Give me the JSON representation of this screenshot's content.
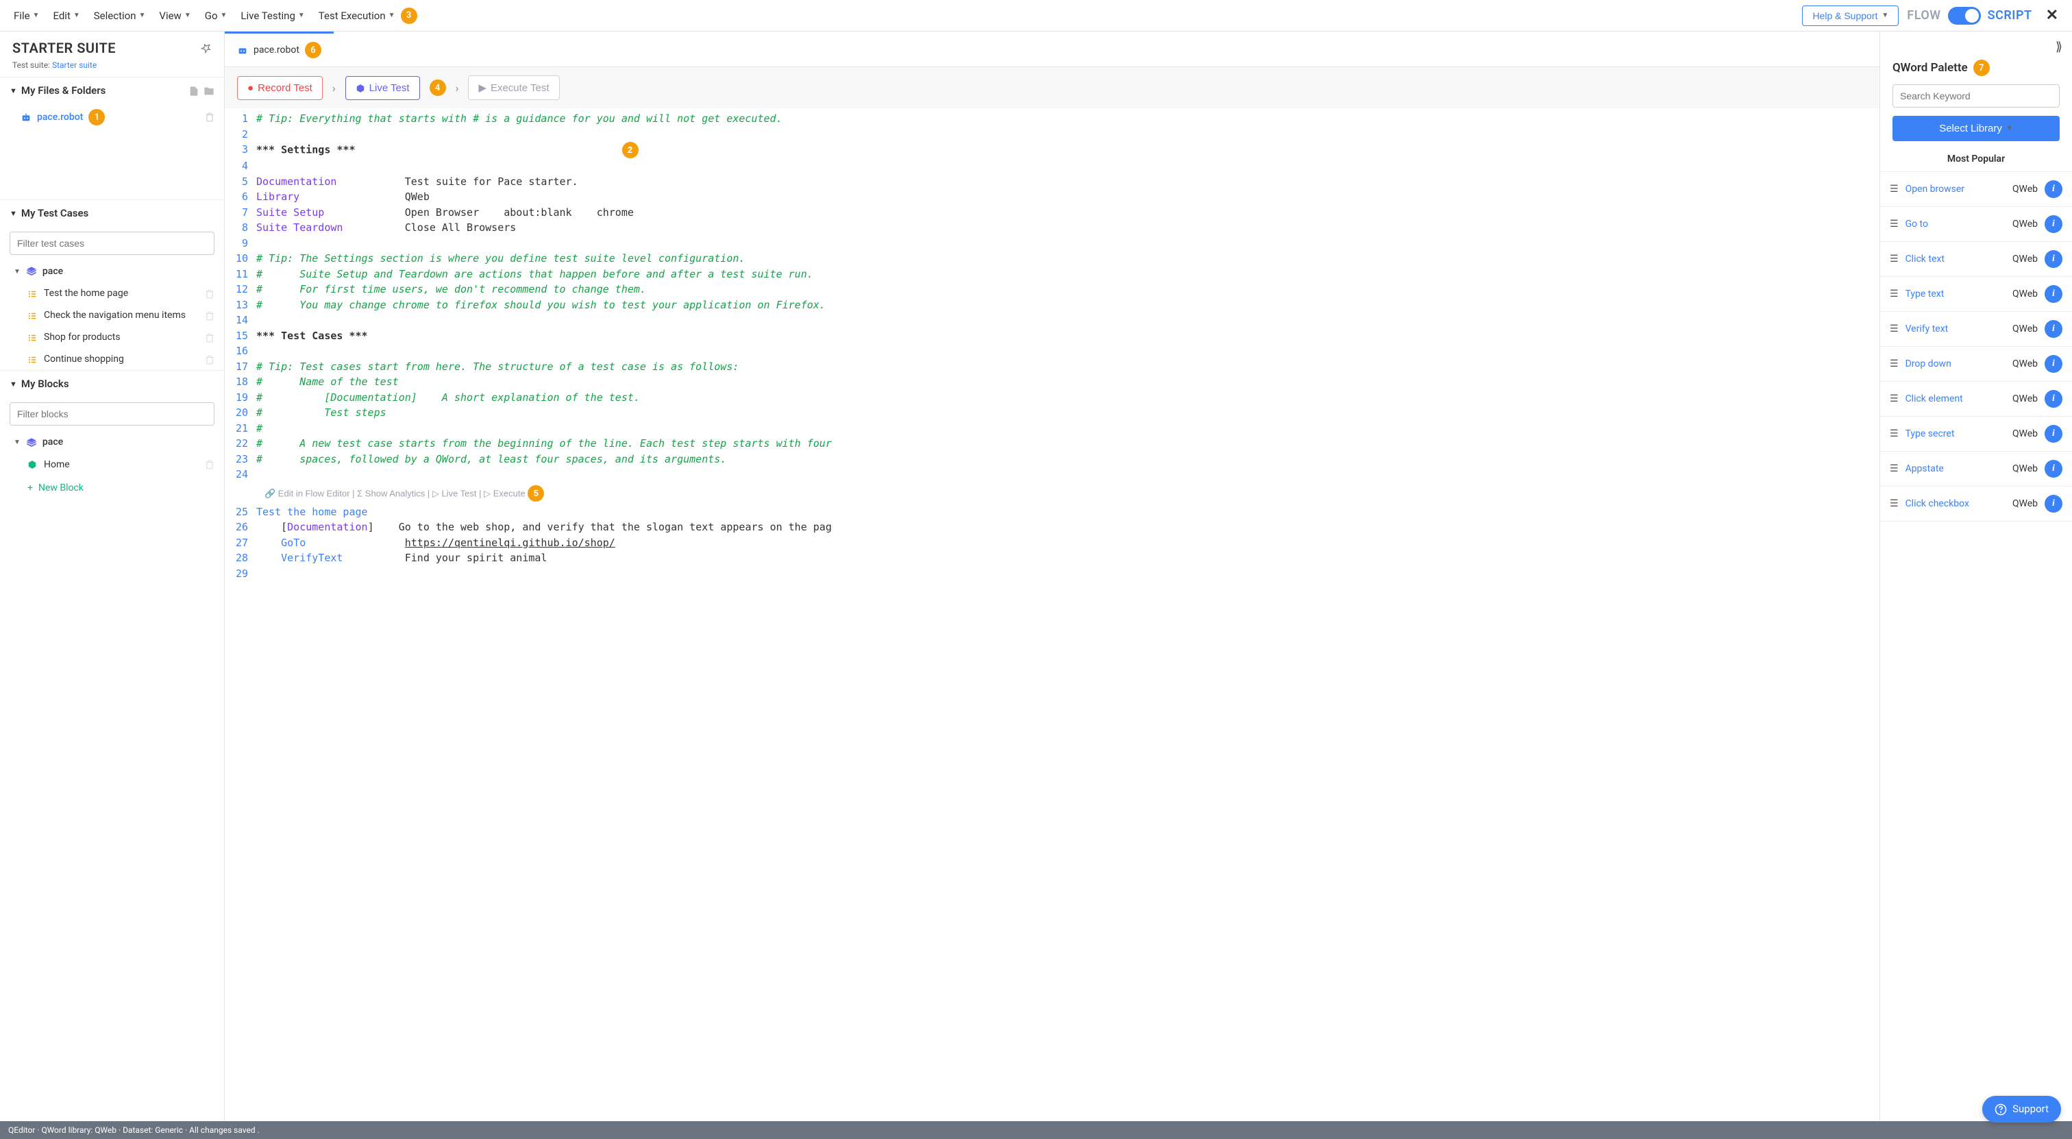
{
  "menubar": {
    "items": [
      "File",
      "Edit",
      "Selection",
      "View",
      "Go",
      "Live Testing",
      "Test Execution"
    ],
    "help": "Help & Support",
    "flow": "FLOW",
    "script": "SCRIPT"
  },
  "badges": {
    "menubar": "3",
    "file": "1",
    "tab": "6",
    "live": "4",
    "code": "2",
    "palette": "7",
    "execute": "5"
  },
  "sidebar": {
    "suite_title": "STARTER SUITE",
    "suite_sub_label": "Test suite: ",
    "suite_sub_link": "Starter suite",
    "files_header": "My Files & Folders",
    "file_name": "pace.robot",
    "testcases_header": "My Test Cases",
    "filter_tc_placeholder": "Filter test cases",
    "tc_group": "pace",
    "testcases": [
      "Test the home page",
      "Check the navigation menu items",
      "Shop for products",
      "Continue shopping"
    ],
    "blocks_header": "My Blocks",
    "filter_blocks_placeholder": "Filter blocks",
    "block_group": "pace",
    "blocks": [
      "Home"
    ],
    "new_block": "New Block"
  },
  "editor": {
    "tab_name": "pace.robot",
    "record": "Record Test",
    "live": "Live Test",
    "execute": "Execute Test",
    "inline_actions": "🔗 Edit in Flow Editor | Σ Show Analytics | ▷ Live Test | ▷ Execute"
  },
  "chart_data": {
    "type": "table",
    "lines": [
      {
        "n": 1,
        "cls": "comment",
        "t": "# Tip: Everything that starts with # is a guidance for you and will not get executed."
      },
      {
        "n": 2,
        "cls": "",
        "t": ""
      },
      {
        "n": 3,
        "cls": "section-mark",
        "t": "*** Settings ***"
      },
      {
        "n": 4,
        "cls": "",
        "t": ""
      },
      {
        "n": 5,
        "k": "Documentation",
        "v": "Test suite for Pace starter."
      },
      {
        "n": 6,
        "k": "Library",
        "v": "QWeb"
      },
      {
        "n": 7,
        "k": "Suite Setup",
        "v": "Open Browser    about:blank    chrome"
      },
      {
        "n": 8,
        "k": "Suite Teardown",
        "v": "Close All Browsers"
      },
      {
        "n": 9,
        "cls": "",
        "t": ""
      },
      {
        "n": 10,
        "cls": "comment",
        "t": "# Tip: The Settings section is where you define test suite level configuration."
      },
      {
        "n": 11,
        "cls": "comment",
        "t": "#      Suite Setup and Teardown are actions that happen before and after a test suite run."
      },
      {
        "n": 12,
        "cls": "comment",
        "t": "#      For first time users, we don't recommend to change them."
      },
      {
        "n": 13,
        "cls": "comment",
        "t": "#      You may change chrome to firefox should you wish to test your application on Firefox."
      },
      {
        "n": 14,
        "cls": "",
        "t": ""
      },
      {
        "n": 15,
        "cls": "section-mark",
        "t": "*** Test Cases ***"
      },
      {
        "n": 16,
        "cls": "",
        "t": ""
      },
      {
        "n": 17,
        "cls": "comment",
        "t": "# Tip: Test cases start from here. The structure of a test case is as follows:"
      },
      {
        "n": 18,
        "cls": "comment",
        "t": "#      Name of the test"
      },
      {
        "n": 19,
        "cls": "comment",
        "t": "#          [Documentation]    A short explanation of the test."
      },
      {
        "n": 20,
        "cls": "comment",
        "t": "#          Test steps"
      },
      {
        "n": 21,
        "cls": "comment",
        "t": "#"
      },
      {
        "n": 22,
        "cls": "comment",
        "t": "#      A new test case starts from the beginning of the line. Each test step starts with four"
      },
      {
        "n": 23,
        "cls": "comment",
        "t": "#      spaces, followed by a QWord, at least four spaces, and its arguments."
      },
      {
        "n": 24,
        "cls": "",
        "t": ""
      },
      {
        "n": 25,
        "cls": "keyword2",
        "t": "Test the home page",
        "tc": true
      },
      {
        "n": 26,
        "doc": true,
        "v": "Go to the web shop, and verify that the slogan text appears on the pag"
      },
      {
        "n": 27,
        "k2": "GoTo",
        "v": "https://qentinelqi.github.io/shop/",
        "link": true
      },
      {
        "n": 28,
        "k2": "VerifyText",
        "v": "Find your spirit animal"
      },
      {
        "n": 29,
        "cls": "",
        "t": ""
      }
    ]
  },
  "palette": {
    "title": "QWord Palette",
    "search_placeholder": "Search Keyword",
    "select_lib": "Select Library",
    "most_popular": "Most Popular",
    "items": [
      {
        "name": "Open browser",
        "lib": "QWeb"
      },
      {
        "name": "Go to",
        "lib": "QWeb"
      },
      {
        "name": "Click text",
        "lib": "QWeb"
      },
      {
        "name": "Type text",
        "lib": "QWeb"
      },
      {
        "name": "Verify text",
        "lib": "QWeb"
      },
      {
        "name": "Drop down",
        "lib": "QWeb"
      },
      {
        "name": "Click element",
        "lib": "QWeb"
      },
      {
        "name": "Type secret",
        "lib": "QWeb"
      },
      {
        "name": "Appstate",
        "lib": "QWeb"
      },
      {
        "name": "Click checkbox",
        "lib": "QWeb"
      }
    ]
  },
  "status": "QEditor · QWord library: QWeb · Dataset: Generic · All changes saved .",
  "support": "Support"
}
